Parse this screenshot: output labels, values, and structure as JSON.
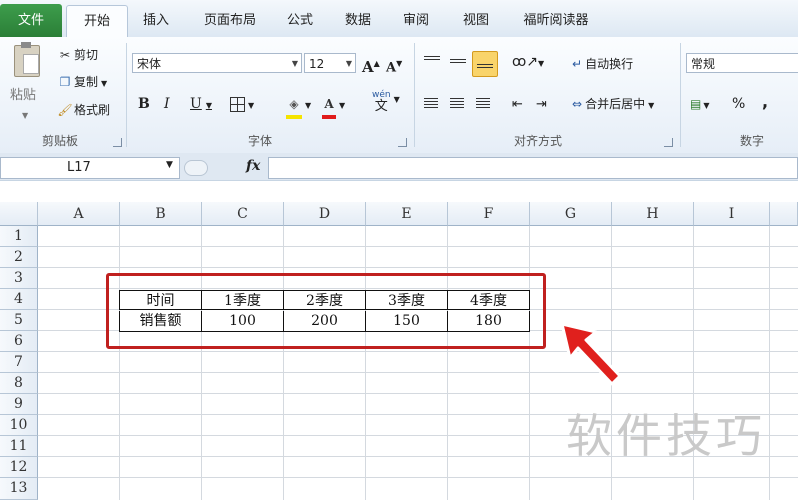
{
  "tabs": [
    "文件",
    "开始",
    "插入",
    "页面布局",
    "公式",
    "数据",
    "审阅",
    "视图",
    "福昕阅读器"
  ],
  "ribbon": {
    "clipboard": {
      "paste": "粘贴",
      "cut": "剪切",
      "copy": "复制",
      "format_painter": "格式刷",
      "label": "剪贴板"
    },
    "font": {
      "name": "宋体",
      "size": "12",
      "grow": "A",
      "shrink": "A",
      "bold": "B",
      "italic": "I",
      "underline": "U",
      "font_color": "A",
      "wen": "wén",
      "wen_char": "文",
      "label": "字体"
    },
    "alignment": {
      "wrap": "自动换行",
      "merge": "合并后居中",
      "label": "对齐方式"
    },
    "number": {
      "format": "常规",
      "percent": "%",
      "comma": ",",
      "label": "数字"
    }
  },
  "formula_bar": {
    "name_box": "L17",
    "fx": "fx",
    "content": ""
  },
  "grid": {
    "columns": [
      "A",
      "B",
      "C",
      "D",
      "E",
      "F",
      "G",
      "H",
      "I"
    ],
    "rows": [
      "1",
      "2",
      "3",
      "4",
      "5",
      "6",
      "7",
      "8",
      "9",
      "10",
      "11",
      "12",
      "13"
    ]
  },
  "table": {
    "header": [
      "时间",
      "1季度",
      "2季度",
      "3季度",
      "4季度"
    ],
    "row": [
      "销售额",
      "100",
      "200",
      "150",
      "180"
    ]
  },
  "colors": {
    "file_tab": "#2b7f37",
    "highlight": "#c0201f",
    "arrow": "#e0201d"
  },
  "watermark": "软件技巧"
}
